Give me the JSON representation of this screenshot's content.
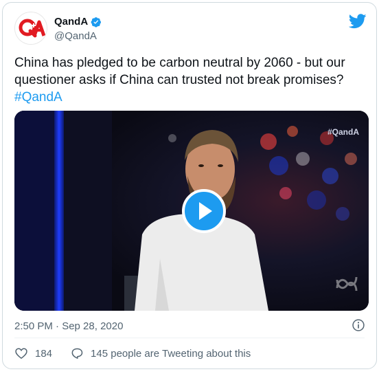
{
  "author": {
    "display_name": "QandA",
    "handle": "@QandA",
    "logo_text": "Q+A",
    "avatar_icon": "qanda-logo",
    "verified_icon": "verified-badge-icon"
  },
  "tweet": {
    "text": "China has pledged to be carbon neutral by 2060 - but our questioner asks if China can trusted not break promises?",
    "hashtag": "#QandA"
  },
  "media": {
    "overlay_tag": "#QandA",
    "play_icon": "play-icon",
    "type": "video"
  },
  "meta": {
    "timestamp": "2:50 PM · Sep 28, 2020",
    "info_icon": "info-icon"
  },
  "actions": {
    "likes": "184",
    "conversation": "145 people are Tweeting about this"
  },
  "colors": {
    "accent": "#1d9bf0",
    "text": "#0f1419",
    "secondary": "#536471",
    "brand_red": "#e11b22"
  }
}
